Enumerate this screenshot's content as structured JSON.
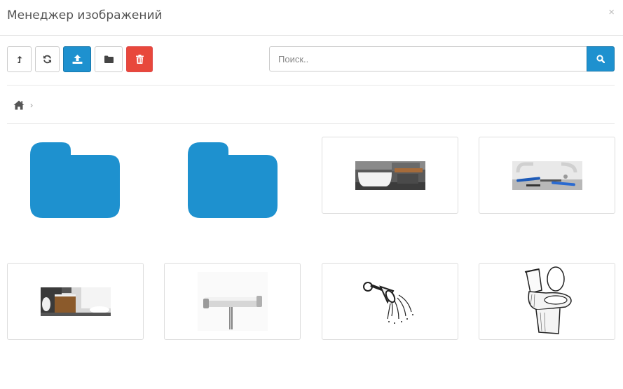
{
  "modal": {
    "title": "Менеджер изображений",
    "close_label": "×"
  },
  "toolbar": {
    "buttons": [
      {
        "name": "parent-directory",
        "icon": "level-up-icon"
      },
      {
        "name": "refresh",
        "icon": "refresh-icon"
      },
      {
        "name": "upload",
        "icon": "upload-icon"
      },
      {
        "name": "new-folder",
        "icon": "folder-icon"
      },
      {
        "name": "delete",
        "icon": "trash-icon"
      }
    ]
  },
  "search": {
    "placeholder": "Поиск..",
    "value": ""
  },
  "breadcrumb": {
    "separator": "›"
  },
  "colors": {
    "primary": "#1e91cf",
    "danger": "#e8483b",
    "folder": "#1e91cf"
  },
  "items": [
    {
      "type": "folder",
      "icon": "folder-icon"
    },
    {
      "type": "folder",
      "icon": "folder-icon"
    },
    {
      "type": "image",
      "depicts": "bathroom-bathtub"
    },
    {
      "type": "image",
      "depicts": "plumbing-tools"
    },
    {
      "type": "image",
      "depicts": "bathroom-interior"
    },
    {
      "type": "image",
      "depicts": "shower-thermostat"
    },
    {
      "type": "image",
      "depicts": "shower-head"
    },
    {
      "type": "image",
      "depicts": "toilet"
    }
  ]
}
